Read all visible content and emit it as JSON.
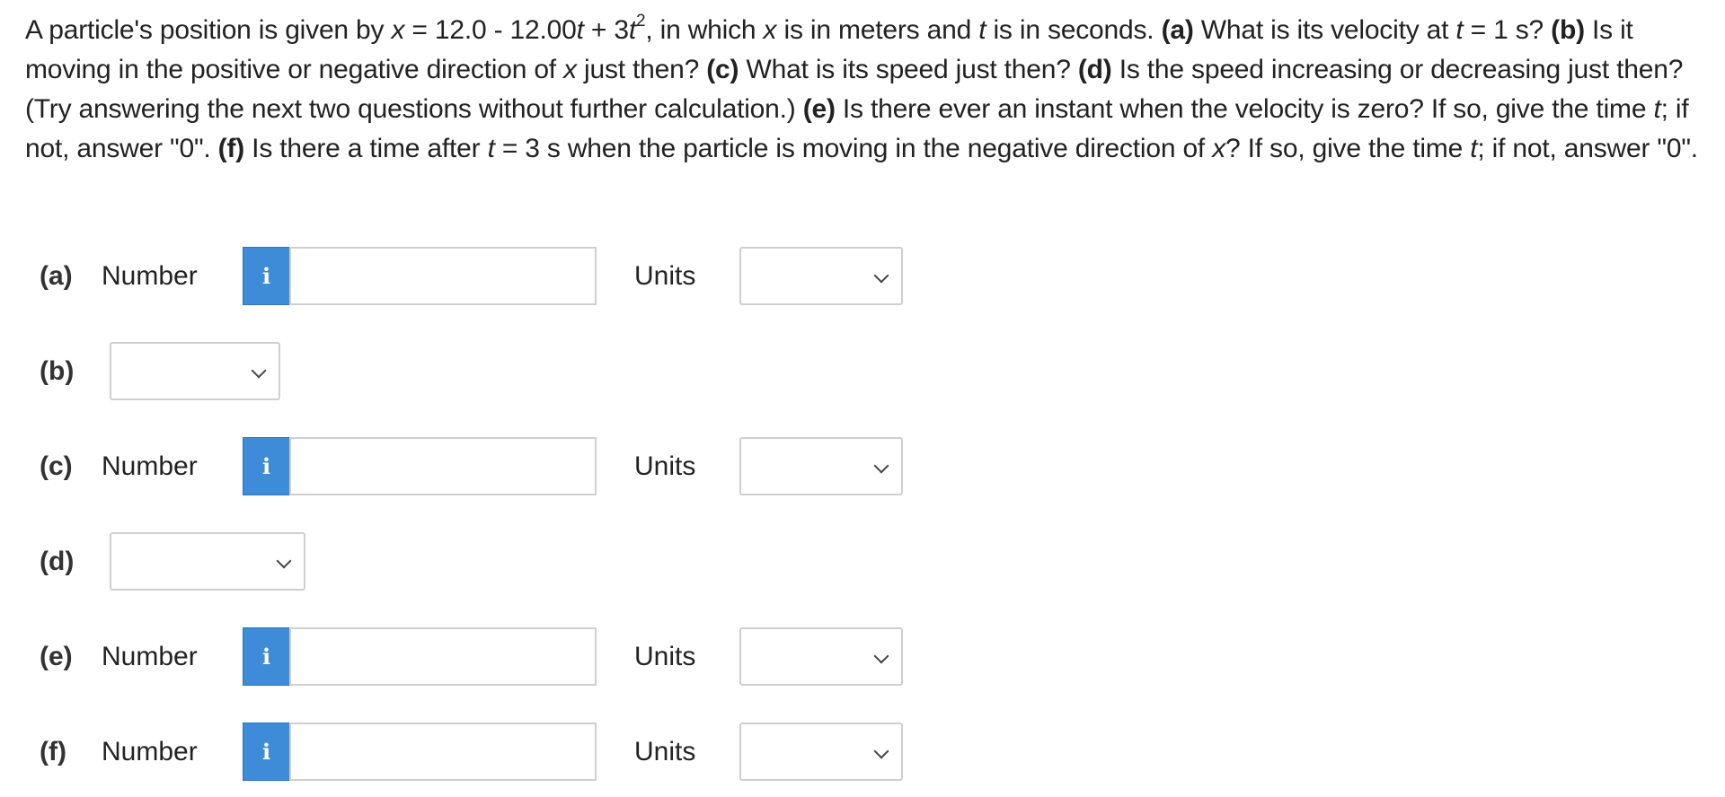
{
  "question": {
    "s1": "A particle's position is given by ",
    "x1": "x",
    "s2": " = 12.0 - 12.00",
    "t1": "t",
    "s3": " + 3",
    "t2": "t",
    "exp": "2",
    "s4": ", in which ",
    "x2": "x",
    "s5": " is in meters and ",
    "t3": "t",
    "s6": " is in seconds. ",
    "a_tag": "(a)",
    "s7": " What is its velocity at ",
    "t4": "t",
    "s8": " = 1 s? ",
    "b_tag": "(b)",
    "s9": " Is it moving in the positive or negative direction of ",
    "x3": "x",
    "s10": " just then? ",
    "c_tag": "(c)",
    "s11": " What is its speed just then? ",
    "d_tag": "(d)",
    "s12": " Is the speed increasing or decreasing just then? (Try answering the next two questions without further calculation.) ",
    "e_tag": "(e)",
    "s13": " Is there ever an instant when the velocity is zero? If so, give the time ",
    "t5": "t",
    "s14": "; if not, answer \"0\". ",
    "f_tag": "(f)",
    "s15": " Is there a time after ",
    "t6": "t",
    "s16": " = 3 s when the particle is moving in the negative direction of ",
    "x4": "x",
    "s17": "? If so, give the time ",
    "t7": "t",
    "s18": "; if not, answer \"0\"."
  },
  "info_icon": "i",
  "icons": {
    "info": "info-icon",
    "dropdown": "chevron-down-icon"
  },
  "colors": {
    "info_button": "#3e8bd7",
    "border": "#cfcfcf"
  },
  "parts": {
    "a": {
      "label": "(a)",
      "number_label": "Number",
      "value": "",
      "units_label": "Units",
      "units_selected": ""
    },
    "b": {
      "label": "(b)",
      "selected": ""
    },
    "c": {
      "label": "(c)",
      "number_label": "Number",
      "value": "",
      "units_label": "Units",
      "units_selected": ""
    },
    "d": {
      "label": "(d)",
      "selected": ""
    },
    "e": {
      "label": "(e)",
      "number_label": "Number",
      "value": "",
      "units_label": "Units",
      "units_selected": ""
    },
    "f": {
      "label": "(f)",
      "number_label": "Number",
      "value": "",
      "units_label": "Units",
      "units_selected": ""
    }
  }
}
